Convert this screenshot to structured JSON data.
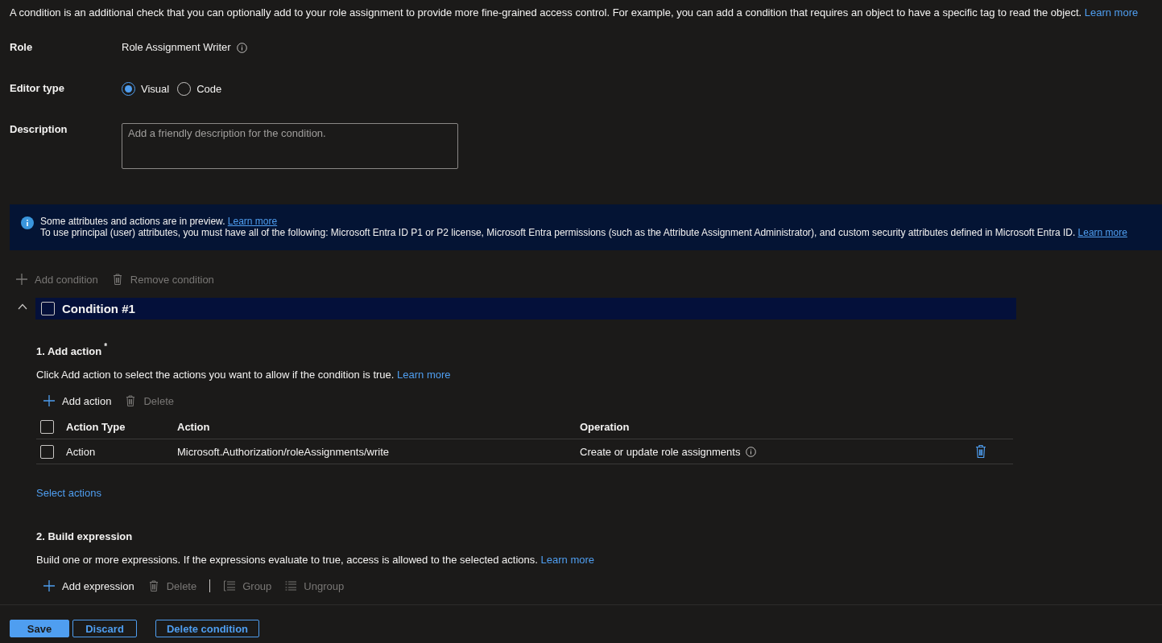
{
  "intro": {
    "text": "A condition is an additional check that you can optionally add to your role assignment to provide more fine-grained access control. For example, you can add a condition that requires an object to have a specific tag to read the object.",
    "link": "Learn more"
  },
  "form": {
    "role": {
      "label": "Role",
      "value": "Role Assignment Writer"
    },
    "editor_type": {
      "label": "Editor type",
      "options": [
        {
          "label": "Visual",
          "selected": true
        },
        {
          "label": "Code",
          "selected": false
        }
      ]
    },
    "description": {
      "label": "Description",
      "placeholder": "Add a friendly description for the condition."
    }
  },
  "banner": {
    "lines": [
      {
        "text": "Some attributes and actions are in preview.",
        "link": "Learn more"
      },
      {
        "text": "To use principal (user) attributes, you must have all of the following: Microsoft Entra ID P1 or P2 license, Microsoft Entra permissions (such as the Attribute Assignment Administrator), and custom security attributes defined in Microsoft Entra ID.",
        "link": "Learn more"
      }
    ]
  },
  "condition_toolbar": [
    {
      "kind": "add",
      "label": "Add condition",
      "disabled": true
    },
    {
      "kind": "delete",
      "label": "Remove condition",
      "disabled": true
    }
  ],
  "condition": {
    "title": "Condition #1",
    "expanded": true,
    "checked": false,
    "add_action": {
      "heading": "1. Add action",
      "required_mark": "*",
      "description": {
        "text": "Click Add action to select the actions you want to allow if the condition is true.",
        "link": "Learn more"
      },
      "toolbar": [
        {
          "kind": "add",
          "label": "Add action",
          "disabled": false
        },
        {
          "kind": "delete",
          "label": "Delete",
          "disabled": true
        }
      ],
      "table": {
        "header_checked": false,
        "columns": [
          "Action Type",
          "Action",
          "Operation"
        ],
        "rows": [
          {
            "checked": false,
            "cells": [
              "Action",
              "Microsoft.Authorization/roleAssignments/write",
              "Create or update role assignments"
            ]
          }
        ]
      },
      "select_link": "Select actions"
    },
    "build_expression": {
      "heading": "2. Build expression",
      "description": {
        "text": "Build one or more expressions. If the expressions evaluate to true, access is allowed to the selected actions.",
        "link": "Learn more"
      },
      "toolbar": [
        {
          "kind": "add",
          "label": "Add expression",
          "disabled": false
        },
        {
          "kind": "delete",
          "label": "Delete",
          "disabled": true
        },
        {
          "kind": "separator"
        },
        {
          "kind": "group",
          "label": "Group",
          "disabled": true
        },
        {
          "kind": "ungroup",
          "label": "Ungroup",
          "disabled": true
        }
      ]
    }
  },
  "footer": [
    {
      "label": "Save",
      "kind": "primary"
    },
    {
      "label": "Discard",
      "kind": "secondary"
    },
    {
      "label": "Delete condition",
      "kind": "secondary"
    }
  ]
}
